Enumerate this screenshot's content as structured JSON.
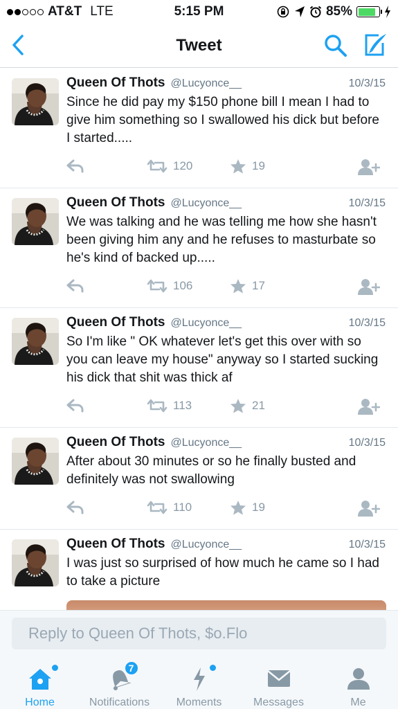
{
  "status_bar": {
    "carrier": "AT&T",
    "network": "LTE",
    "time": "5:15 PM",
    "battery": "85%",
    "battery_level": 0.85,
    "battery_color": "#4cd964"
  },
  "nav": {
    "title": "Tweet",
    "accent_color": "#1da1f2"
  },
  "tweets": [
    {
      "name": "Queen Of Thots",
      "handle": "@Lucyonce__",
      "date": "10/3/15",
      "text": "Since he did pay my $150 phone bill I mean I had to give him something so I swallowed his dick but before I started.....",
      "retweets": "120",
      "likes": "19"
    },
    {
      "name": "Queen Of Thots",
      "handle": "@Lucyonce__",
      "date": "10/3/15",
      "text": "We was talking and he was telling me how she hasn't been giving him any and he refuses to masturbate so he's kind of backed up.....",
      "retweets": "106",
      "likes": "17"
    },
    {
      "name": "Queen Of Thots",
      "handle": "@Lucyonce__",
      "date": "10/3/15",
      "text": "So I'm like \" OK whatever let's get this over with so you can leave my house\" anyway so I started sucking his dick that shit was thick af",
      "retweets": "113",
      "likes": "21"
    },
    {
      "name": "Queen Of Thots",
      "handle": "@Lucyonce__",
      "date": "10/3/15",
      "text": "After about 30 minutes or so he finally busted and definitely was not swallowing",
      "retweets": "110",
      "likes": "19"
    },
    {
      "name": "Queen Of Thots",
      "handle": "@Lucyonce__",
      "date": "10/3/15",
      "text": "I was just so surprised of how much he came so I had to take a picture",
      "retweets": "",
      "likes": ""
    }
  ],
  "reply": {
    "placeholder": "Reply to Queen Of Thots, $o.Flo"
  },
  "tabs": [
    {
      "label": "Home",
      "icon": "home-icon",
      "active": true
    },
    {
      "label": "Notifications",
      "icon": "bell-icon",
      "badge": "7"
    },
    {
      "label": "Moments",
      "icon": "lightning-icon"
    },
    {
      "label": "Messages",
      "icon": "envelope-icon"
    },
    {
      "label": "Me",
      "icon": "person-icon"
    }
  ]
}
